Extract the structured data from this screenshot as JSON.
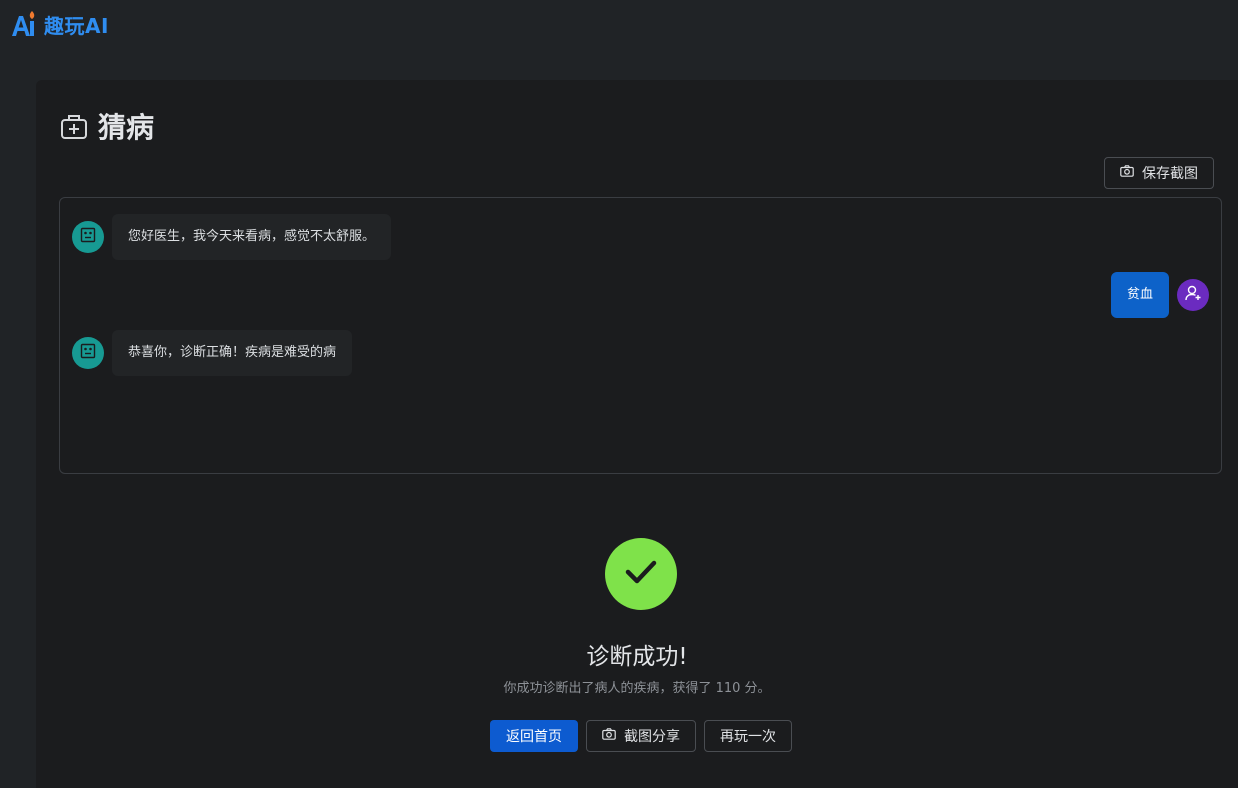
{
  "app": {
    "logo_text": "趣玩AI"
  },
  "page": {
    "title": "猜病"
  },
  "toolbar": {
    "save_screenshot_label": "保存截图"
  },
  "chat": {
    "messages": [
      {
        "role": "bot",
        "text": "您好医生，我今天来看病，感觉不太舒服。"
      },
      {
        "role": "user",
        "text": "贫血"
      },
      {
        "role": "bot",
        "text": "恭喜你，诊断正确！疾病是难受的病"
      }
    ]
  },
  "result": {
    "title": "诊断成功!",
    "description": "你成功诊断出了病人的疾病，获得了 110 分。",
    "buttons": {
      "home": "返回首页",
      "share": "截图分享",
      "replay": "再玩一次"
    }
  },
  "colors": {
    "accent": "#2f8df0",
    "primary_button": "#0d5bd0",
    "user_bubble": "#0d62c9",
    "bot_avatar": "#179a93",
    "user_avatar": "#6b2bc0",
    "success": "#7fe24a"
  },
  "icons": {
    "logo": "ai-logo-icon",
    "title": "medical-kit-icon",
    "camera": "camera-icon",
    "bot": "robot-face-icon",
    "user": "user-add-icon",
    "success": "checkmark-icon"
  }
}
